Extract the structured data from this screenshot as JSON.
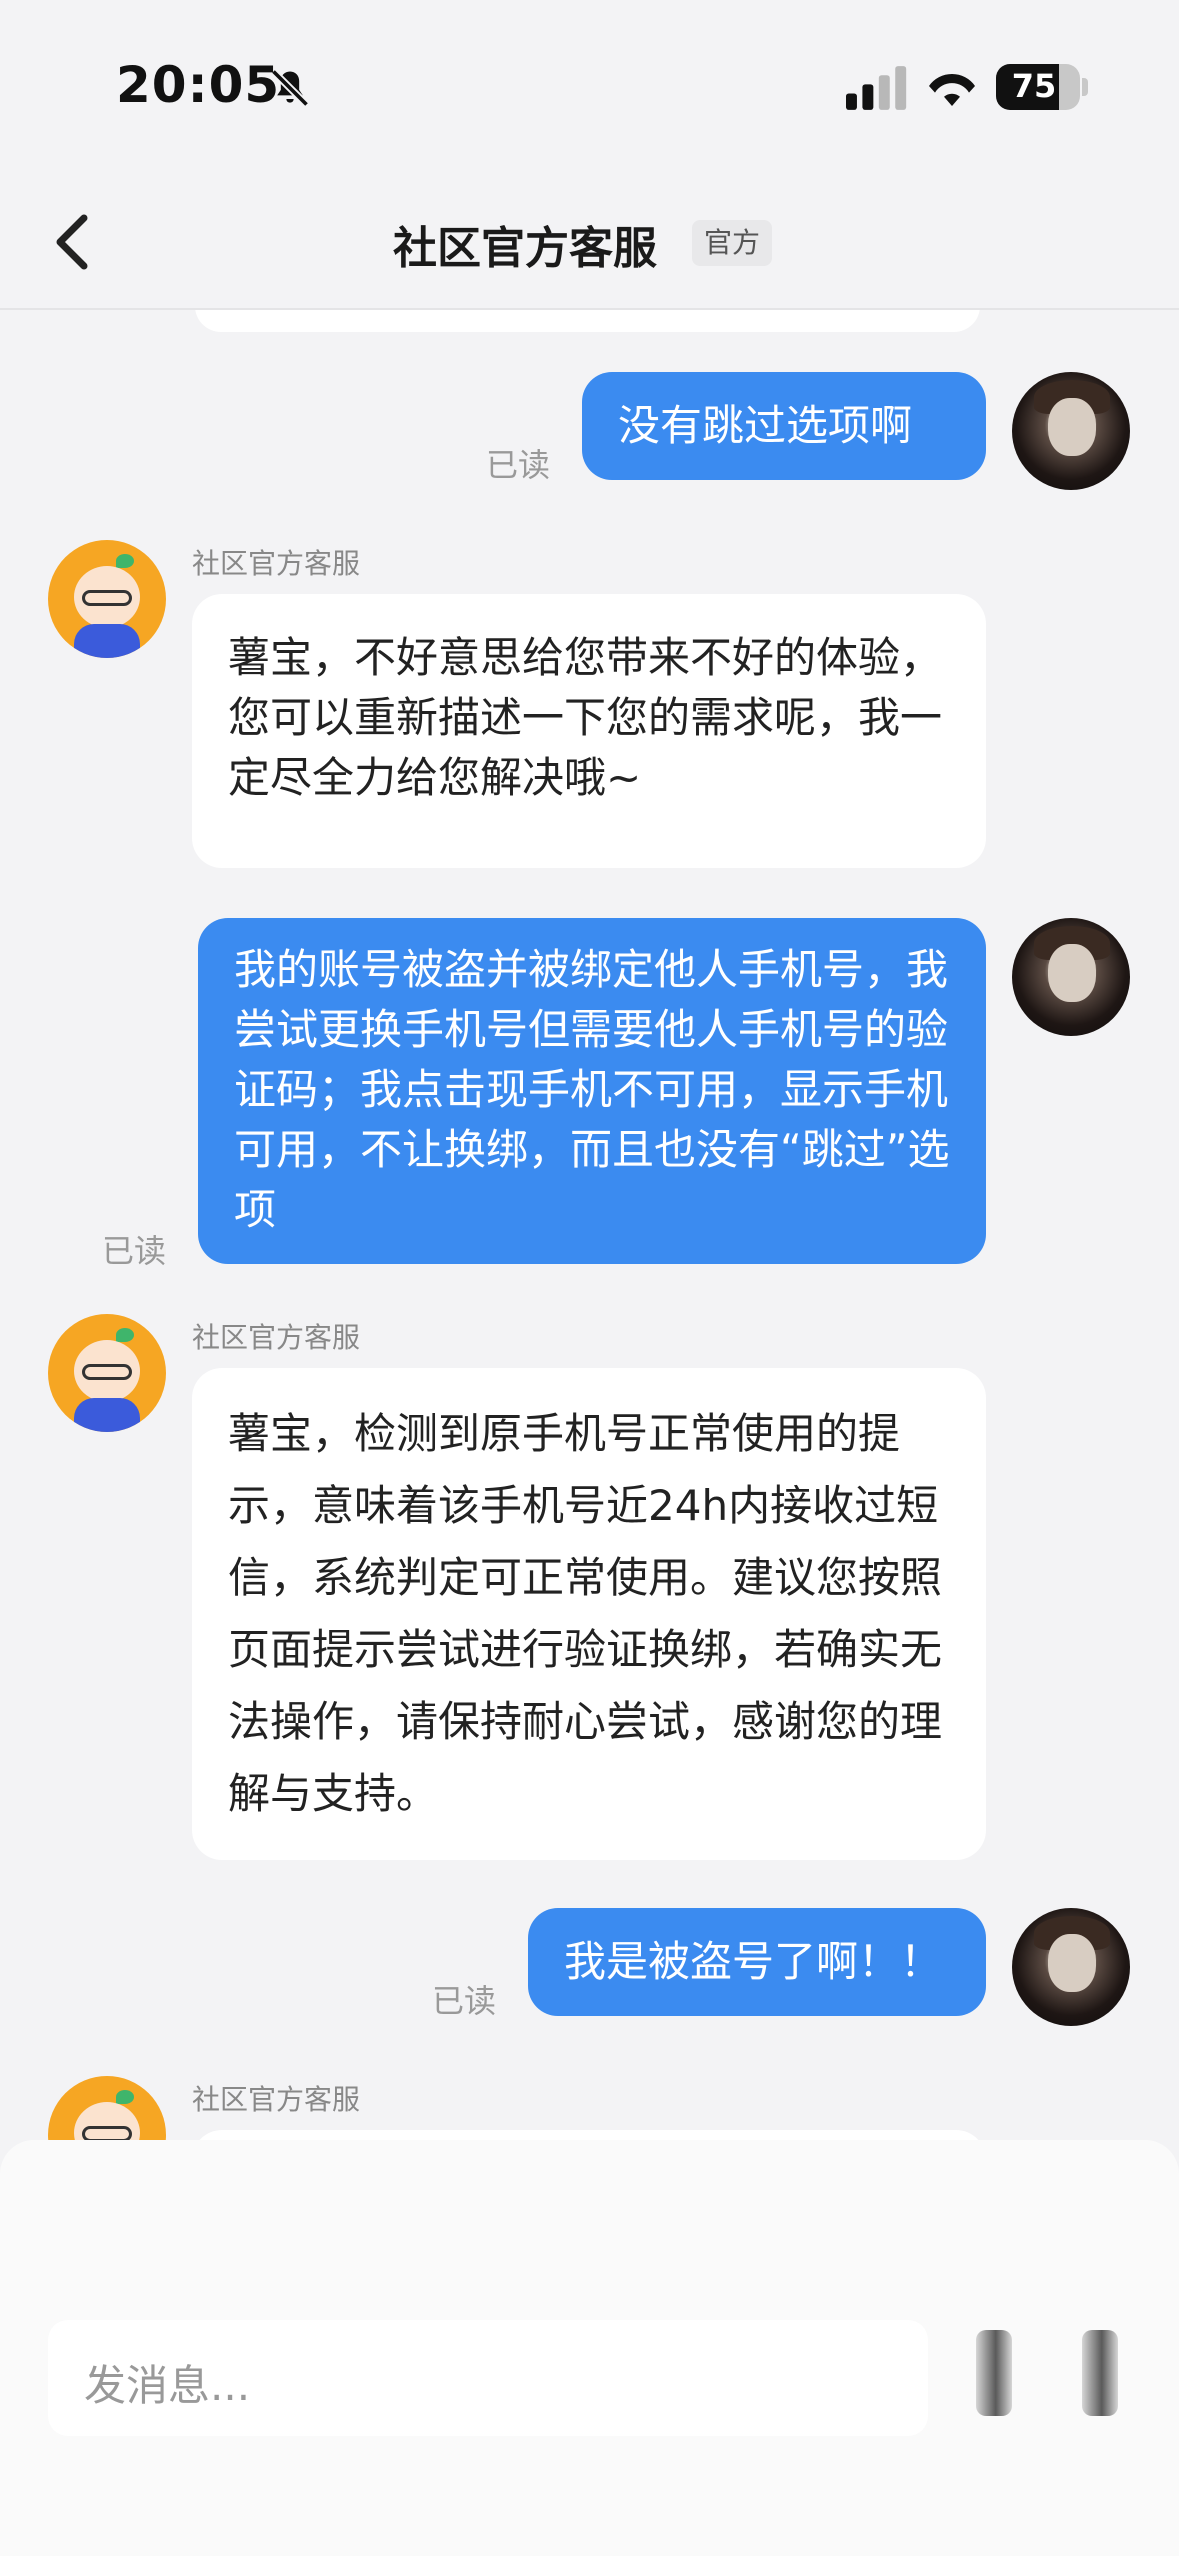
{
  "status_bar": {
    "time": "20:05",
    "battery": "75"
  },
  "nav": {
    "title": "社区官方客服",
    "badge": "官方"
  },
  "messages": [
    {
      "type": "sent",
      "text": "没有跳过选项啊",
      "status": "已读"
    },
    {
      "type": "received",
      "sender": "社区官方客服",
      "text": "薯宝，不好意思给您带来不好的体验，您可以重新描述一下您的需求呢，我一定尽全力给您解决哦~"
    },
    {
      "type": "sent",
      "text": "我的账号被盗并被绑定他人手机号，我尝试更换手机号但需要他人手机号的验证码；我点击现手机不可用，显示手机可用，不让换绑，而且也没有“跳过”选项",
      "status": "已读"
    },
    {
      "type": "received",
      "sender": "社区官方客服",
      "text": "薯宝，检测到原手机号正常使用的提示，意味着该手机号近24h内接收过短信，系统判定可正常使用。建议您按照页面提示尝试进行验证换绑，若确实无法操作，请保持耐心尝试，感谢您的理解与支持。"
    },
    {
      "type": "sent",
      "text": "我是被盗号了啊！！",
      "status": "已读"
    },
    {
      "type": "received",
      "sender": "社区官方客服",
      "text": ""
    }
  ],
  "input": {
    "placeholder": "发消息..."
  },
  "colors": {
    "sent_bubble": "#3b8bf0",
    "background": "#f3f3f5"
  }
}
